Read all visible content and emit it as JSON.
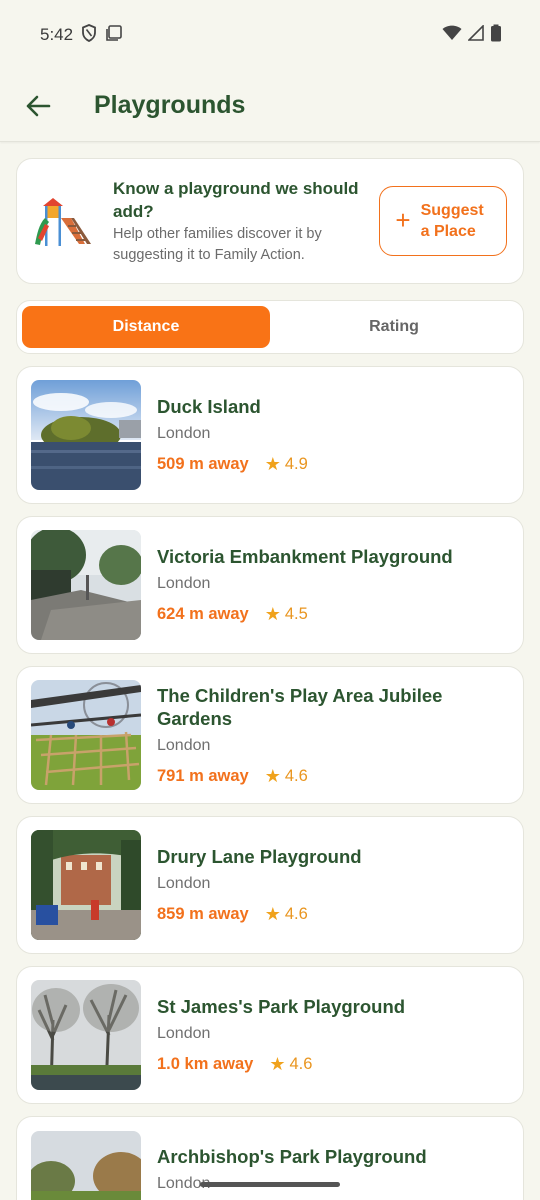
{
  "status": {
    "time": "5:42"
  },
  "appbar": {
    "title": "Playgrounds"
  },
  "promo": {
    "title": "Know a playground we should add?",
    "subtitle": "Help other families discover it by suggesting it to Family Action.",
    "button_label": "Suggest a Place"
  },
  "sort": {
    "options": [
      "Distance",
      "Rating"
    ],
    "selected": "Distance"
  },
  "playgrounds": [
    {
      "name": "Duck Island",
      "city": "London",
      "distance": "509 m away",
      "rating": "4.9"
    },
    {
      "name": "Victoria Embankment Playground",
      "city": "London",
      "distance": "624 m away",
      "rating": "4.5"
    },
    {
      "name": "The Children's Play Area Jubilee Gardens",
      "city": "London",
      "distance": "791 m away",
      "rating": "4.6"
    },
    {
      "name": "Drury Lane Playground",
      "city": "London",
      "distance": "859 m away",
      "rating": "4.6"
    },
    {
      "name": "St James's Park Playground",
      "city": "London",
      "distance": "1.0 km away",
      "rating": "4.6"
    },
    {
      "name": "Archbishop's Park Playground",
      "city": "London"
    }
  ],
  "colors": {
    "accent": "#f97316",
    "title_green": "#2c5530",
    "background": "#f6f6ee"
  }
}
